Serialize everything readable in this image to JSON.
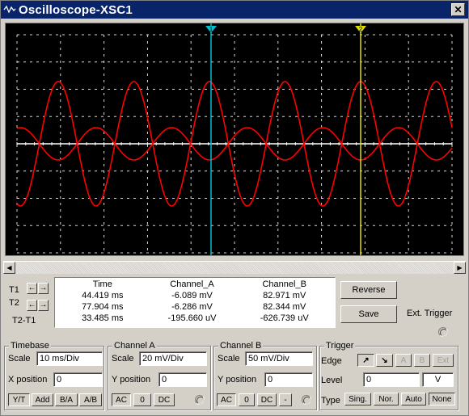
{
  "window": {
    "title": "Oscilloscope-XSC1",
    "close_glyph": "✕"
  },
  "screen": {
    "background": "#000000",
    "grid_color": "#ffffff",
    "trace_a_color": "#ff0000",
    "trace_b_color": "#ff0000",
    "cursor1_color": "#00c0d0",
    "cursor2_color": "#e0e000",
    "cursor1_label": "1",
    "cursor2_label": "2"
  },
  "readout": {
    "headers": [
      "Time",
      "Channel_A",
      "Channel_B"
    ],
    "row_labels": [
      "T1",
      "T2",
      "T2-T1"
    ],
    "rows": [
      [
        "44.419 ms",
        "-6.089 mV",
        "82.971 mV"
      ],
      [
        "77.904 ms",
        "-6.286 mV",
        "82.344 mV"
      ],
      [
        "33.485 ms",
        "-195.660 uV",
        "-626.739 uV"
      ]
    ]
  },
  "buttons": {
    "reverse": "Reverse",
    "save": "Save",
    "ext_trigger": "Ext. Trigger"
  },
  "timebase": {
    "title": "Timebase",
    "scale_label": "Scale",
    "scale_value": "10 ms/Div",
    "xpos_label": "X position",
    "xpos_value": "0",
    "modes": [
      "Y/T",
      "Add",
      "B/A",
      "A/B"
    ]
  },
  "channel_a": {
    "title": "Channel A",
    "scale_label": "Scale",
    "scale_value": "20 mV/Div",
    "ypos_label": "Y position",
    "ypos_value": "0",
    "coupling": [
      "AC",
      "0",
      "DC"
    ]
  },
  "channel_b": {
    "title": "Channel B",
    "scale_label": "Scale",
    "scale_value": "50 mV/Div",
    "ypos_label": "Y position",
    "ypos_value": "0",
    "coupling": [
      "AC",
      "0",
      "DC",
      "-"
    ]
  },
  "trigger": {
    "title": "Trigger",
    "edge_label": "Edge",
    "edge_buttons": [
      "↗",
      "↘",
      "A",
      "B",
      "Ext"
    ],
    "level_label": "Level",
    "level_value": "0",
    "level_unit": "V",
    "type_label": "Type",
    "types": [
      "Sing.",
      "Nor.",
      "Auto",
      "None"
    ]
  }
}
